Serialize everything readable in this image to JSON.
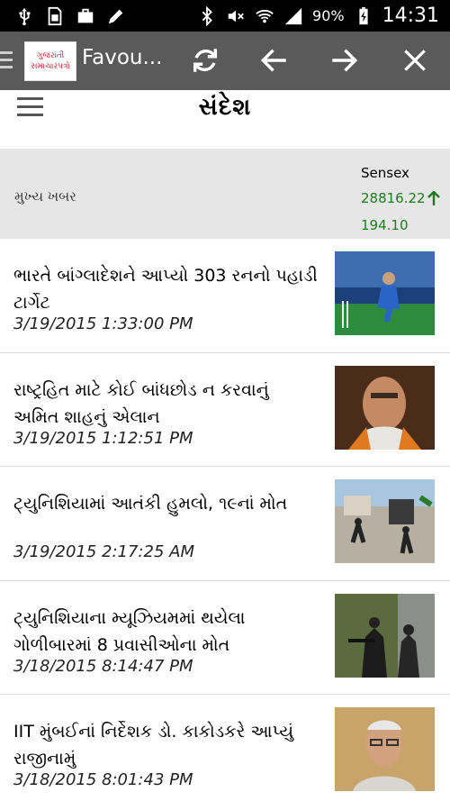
{
  "statusbar": {
    "battery": "90%",
    "time": "14:31"
  },
  "actionbar": {
    "logo_line1": "ગુજરાતી",
    "logo_line2": "સમાચારપત્રો",
    "title": "Favou..."
  },
  "app": {
    "brand": "સંદેશ"
  },
  "sensex": {
    "section_label": "મુખ્ય ખબર",
    "title": "Sensex",
    "value": "28816.22",
    "change": "194.10",
    "color": "#1e7a1e"
  },
  "news": [
    {
      "title": "ભારતે બાંગ્લાદેશને આપ્યો 303 રનનો પહાડી ટાર્ગેટ",
      "time": "3/19/2015 1:33:00 PM",
      "thumb": "cricket-photo"
    },
    {
      "title": "રાષ્ટ્રહિત માટે કોઈ બાંધછોડ ન કરવાનું અમિત શાહનું એલાન",
      "time": "3/19/2015 1:12:51 PM",
      "thumb": "portrait-photo"
    },
    {
      "title": "ટ્યુનિશિયામાં આતંકી હુમલો, ૧૯નાં મોત",
      "time": "3/19/2015 2:17:25 AM",
      "thumb": "street-photo"
    },
    {
      "title": "ટ્યુનિશિયાના મ્યૂઝિયમમાં થયેલા ગોળીબારમાં 8 પ્રવાસીઓના મોત",
      "time": "3/18/2015 8:14:47 PM",
      "thumb": "armed-men-photo"
    },
    {
      "title": "IIT મુંબઈનાં નિર્દેશક ડો. કાકોડકરે આપ્યું રાજીનામું",
      "time": "3/18/2015 8:01:43 PM",
      "thumb": "man-photo"
    }
  ]
}
